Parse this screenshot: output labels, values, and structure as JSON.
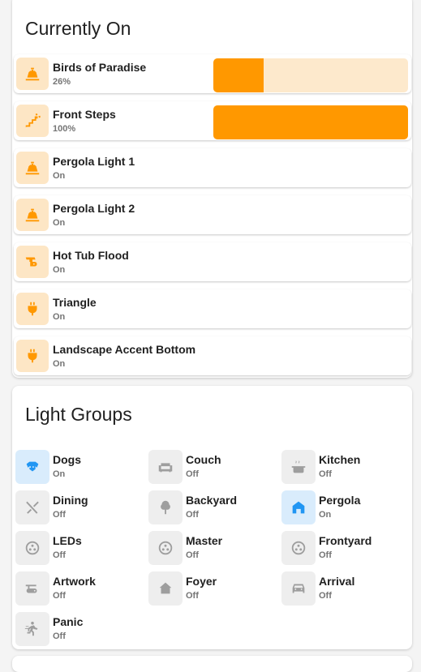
{
  "colors": {
    "accent_on": "#ff9800",
    "group_on": "#2196f3",
    "off_icon": "#9e9e9e"
  },
  "currently_on": {
    "title": "Currently On",
    "tiles": [
      {
        "name": "Birds of Paradise",
        "state": "26%",
        "icon": "landscape-light-icon",
        "brightness": 26
      },
      {
        "name": "Front Steps",
        "state": "100%",
        "icon": "stairs-light-icon",
        "brightness": 100
      },
      {
        "name": "Pergola Light 1",
        "state": "On",
        "icon": "landscape-light-icon"
      },
      {
        "name": "Pergola Light 2",
        "state": "On",
        "icon": "landscape-light-icon"
      },
      {
        "name": "Hot Tub Flood",
        "state": "On",
        "icon": "spotlight-icon"
      },
      {
        "name": "Triangle",
        "state": "On",
        "icon": "power-plug-icon"
      },
      {
        "name": "Landscape Accent Bottom",
        "state": "On",
        "icon": "power-plug-icon"
      }
    ]
  },
  "light_groups": {
    "title": "Light Groups",
    "items": [
      {
        "name": "Dogs",
        "state": "On",
        "icon": "dog-icon"
      },
      {
        "name": "Couch",
        "state": "Off",
        "icon": "sofa-icon"
      },
      {
        "name": "Kitchen",
        "state": "Off",
        "icon": "pot-steam-icon"
      },
      {
        "name": "Dining",
        "state": "Off",
        "icon": "silverware-icon"
      },
      {
        "name": "Backyard",
        "state": "Off",
        "icon": "tree-icon"
      },
      {
        "name": "Pergola",
        "state": "On",
        "icon": "home-icon"
      },
      {
        "name": "LEDs",
        "state": "Off",
        "icon": "led-strip-icon"
      },
      {
        "name": "Master",
        "state": "Off",
        "icon": "led-strip-icon"
      },
      {
        "name": "Frontyard",
        "state": "Off",
        "icon": "led-strip-icon"
      },
      {
        "name": "Artwork",
        "state": "Off",
        "icon": "projector-icon"
      },
      {
        "name": "Foyer",
        "state": "Off",
        "icon": "home-import-icon"
      },
      {
        "name": "Arrival",
        "state": "Off",
        "icon": "car-icon"
      },
      {
        "name": "Panic",
        "state": "Off",
        "icon": "run-icon"
      }
    ]
  }
}
